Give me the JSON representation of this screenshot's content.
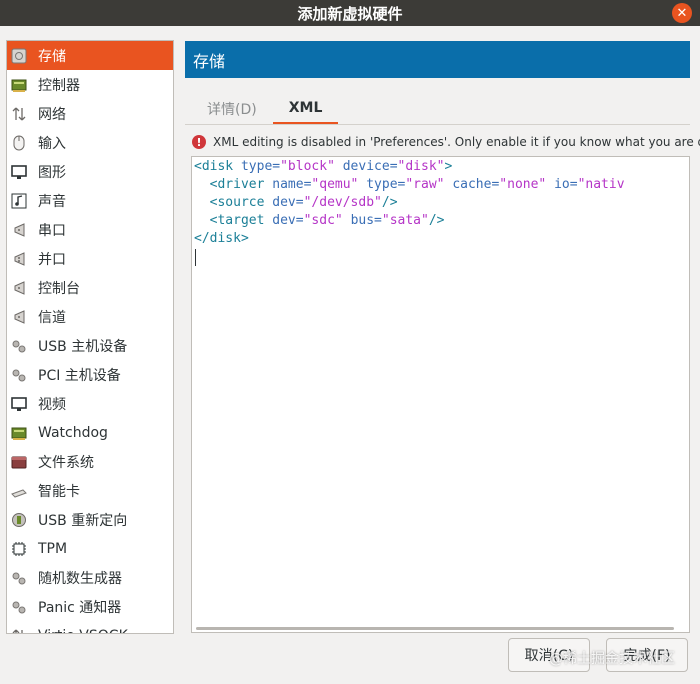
{
  "window": {
    "title": "添加新虚拟硬件",
    "close_glyph": "✕"
  },
  "sidebar": {
    "selected": 0,
    "items": [
      {
        "label": "存储",
        "icon": "disk-icon"
      },
      {
        "label": "控制器",
        "icon": "controller-icon"
      },
      {
        "label": "网络",
        "icon": "network-icon"
      },
      {
        "label": "输入",
        "icon": "mouse-icon"
      },
      {
        "label": "图形",
        "icon": "monitor-icon"
      },
      {
        "label": "声音",
        "icon": "sound-icon"
      },
      {
        "label": "串口",
        "icon": "serial-port-icon"
      },
      {
        "label": "并口",
        "icon": "parallel-port-icon"
      },
      {
        "label": "控制台",
        "icon": "console-icon"
      },
      {
        "label": "信道",
        "icon": "channel-icon"
      },
      {
        "label": "USB 主机设备",
        "icon": "usb-host-icon"
      },
      {
        "label": "PCI 主机设备",
        "icon": "pci-host-icon"
      },
      {
        "label": "视频",
        "icon": "video-icon"
      },
      {
        "label": "Watchdog",
        "icon": "watchdog-icon"
      },
      {
        "label": "文件系统",
        "icon": "filesystem-icon"
      },
      {
        "label": "智能卡",
        "icon": "smartcard-icon"
      },
      {
        "label": "USB 重新定向",
        "icon": "usb-redirect-icon"
      },
      {
        "label": "TPM",
        "icon": "tpm-icon"
      },
      {
        "label": "随机数生成器",
        "icon": "rng-icon"
      },
      {
        "label": "Panic 通知器",
        "icon": "panic-icon"
      },
      {
        "label": "Virtio VSOCK",
        "icon": "vsock-icon"
      }
    ]
  },
  "header": {
    "title": "存储"
  },
  "tabs": [
    {
      "label": "详情(D)",
      "active": false
    },
    {
      "label": "XML",
      "active": true
    }
  ],
  "warning": {
    "icon": "error-icon",
    "text": "XML editing is disabled in 'Preferences'. Only enable it if you know what you are doing."
  },
  "xml": {
    "l1": {
      "tag_open": "<disk",
      "a1": "type=",
      "v1": "\"block\"",
      "a2": "device=",
      "v2": "\"disk\"",
      "tag_close": ">"
    },
    "l2": {
      "tag_open": "<driver",
      "a1": "name=",
      "v1": "\"qemu\"",
      "a2": "type=",
      "v2": "\"raw\"",
      "a3": "cache=",
      "v3": "\"none\"",
      "a4": "io=",
      "v4": "\"nativ"
    },
    "l3": {
      "tag_open": "<source",
      "a1": "dev=",
      "v1": "\"/dev/sdb\"",
      "tag_close": "/>"
    },
    "l4": {
      "tag_open": "<target",
      "a1": "dev=",
      "v1": "\"sdc\"",
      "a2": "bus=",
      "v2": "\"sata\"",
      "tag_close": "/>"
    },
    "l5": {
      "tag": "</disk>"
    }
  },
  "buttons": {
    "cancel": "取消(C)",
    "finish": "完成(F)"
  },
  "watermark": "@稀土掘金技术社区",
  "colors": {
    "accent": "#e95420",
    "header": "#0a6eaa",
    "error": "#d0363a"
  }
}
